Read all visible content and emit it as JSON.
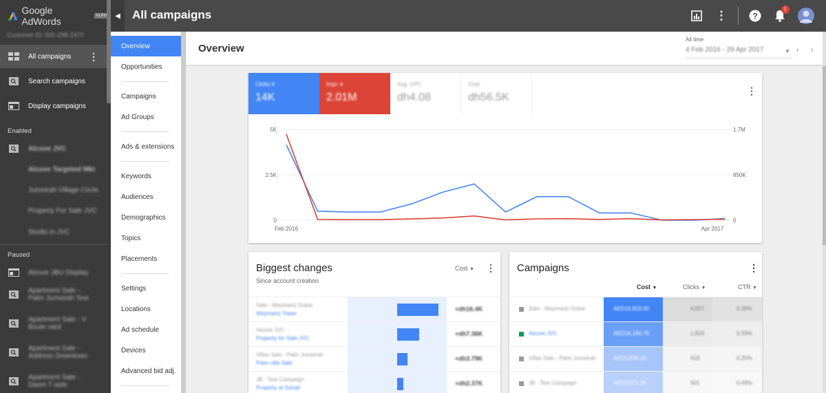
{
  "app": {
    "name": "Google AdWords",
    "badge": "ALPHA",
    "customer_id": "Customer ID: 591-298-1970"
  },
  "sidebar": {
    "top": [
      {
        "label": "All campaigns",
        "icon": "grid-icon"
      },
      {
        "label": "Search campaigns",
        "icon": "search-icon"
      },
      {
        "label": "Display campaigns",
        "icon": "display-icon"
      }
    ],
    "enabled_heading": "Enabled",
    "enabled": [
      {
        "label": "Alcove JVC",
        "icon": "search-icon",
        "bold": true
      },
      {
        "label": "Alcove Targeted Mkt",
        "bold": true
      },
      {
        "label": "Jumeirah Village Circle"
      },
      {
        "label": "Property For Sale JVC"
      },
      {
        "label": "Studio in JVC"
      }
    ],
    "paused_heading": "Paused",
    "paused": [
      {
        "label": "Alcove JBU Display",
        "icon": "display-icon"
      },
      {
        "label": "Apartment Sale - Palm Jumeirah Test",
        "icon": "search-icon"
      },
      {
        "label": "Apartment Sale - V Boule vard",
        "icon": "search-icon"
      },
      {
        "label": "Apartment Sale - Address Downtown",
        "icon": "search-icon"
      },
      {
        "label": "Apartment Sale - Dasm T aste",
        "icon": "search-icon"
      }
    ]
  },
  "topbar": {
    "title": "All campaigns",
    "notification_badge": "!"
  },
  "subnav": [
    {
      "label": "Overview",
      "active": true
    },
    {
      "label": "Opportunities"
    },
    {
      "label": "Campaigns"
    },
    {
      "label": "Ad Groups"
    },
    {
      "label": "Ads & extensions"
    },
    {
      "label": "Keywords"
    },
    {
      "label": "Audiences"
    },
    {
      "label": "Demographics"
    },
    {
      "label": "Topics"
    },
    {
      "label": "Placements"
    },
    {
      "label": "Settings"
    },
    {
      "label": "Locations"
    },
    {
      "label": "Ad schedule"
    },
    {
      "label": "Devices"
    },
    {
      "label": "Advanced bid adj."
    }
  ],
  "overview": {
    "title": "Overview",
    "date_label": "All time",
    "date_range": "4 Feb 2016 - 29 Apr 2017"
  },
  "metrics": [
    {
      "label": "Clicks ▾",
      "value": "14K",
      "color": "#4285f4"
    },
    {
      "label": "Impr. ▾",
      "value": "2.01M",
      "color": "#db4437"
    },
    {
      "label": "Avg. CPC",
      "value": "dh4.08",
      "color": "#ffffff"
    },
    {
      "label": "Cost",
      "value": "dh56.5K",
      "color": "#ffffff"
    }
  ],
  "chart_data": {
    "type": "line",
    "x": [
      "Feb 2016",
      "",
      "",
      "",
      "",
      "",
      "",
      "",
      "",
      "",
      "",
      "",
      "",
      "",
      "Apr 2017"
    ],
    "x_tick_labels": [
      "Feb 2016",
      "Apr 2017"
    ],
    "y_left": {
      "ticks": [
        "0",
        "2.5K",
        "5K"
      ],
      "range": [
        0,
        5000
      ]
    },
    "y_right": {
      "ticks": [
        "0",
        "850K",
        "1.7M"
      ],
      "range": [
        0,
        1700000
      ]
    },
    "series": [
      {
        "color": "#4285f4",
        "axis": "left",
        "values": [
          4150,
          500,
          450,
          450,
          900,
          1550,
          2000,
          450,
          1300,
          1300,
          400,
          400,
          0,
          0,
          100
        ]
      },
      {
        "color": "#db4437",
        "axis": "right",
        "values": [
          1610000,
          16000,
          12000,
          12000,
          25000,
          42000,
          80000,
          8000,
          26000,
          30000,
          16000,
          30000,
          8000,
          12000,
          18000
        ]
      }
    ]
  },
  "biggest_changes": {
    "title": "Biggest changes",
    "subtitle": "Since account creation",
    "sort_label": "Cost",
    "rows": [
      {
        "name": "Sale - Waymartz Dubai",
        "link": "Waymartz Tower",
        "bar": 0.8,
        "value": "+dh16.4K"
      },
      {
        "name": "Alcove JVC",
        "link": "Property for Sale JVC",
        "bar": 0.42,
        "value": "+dh7.36K"
      },
      {
        "name": "Villas Sale - Palm Jumeirah",
        "link": "Palm villa Sale",
        "bar": 0.2,
        "value": "+dh3.79K"
      },
      {
        "name": "JB - Test Campaign",
        "link": "Property at Sohail",
        "bar": 0.12,
        "value": "+dh2.37K"
      }
    ]
  },
  "campaigns": {
    "title": "Campaigns",
    "columns": [
      "Cost",
      "Clicks",
      "CTR"
    ],
    "rows": [
      {
        "name": "Sale - Waymartz Dubai",
        "status": "#999999",
        "cost": "AED16,819.00",
        "clicks": "4,007",
        "ctr": "0.39%"
      },
      {
        "name": "Alcove JVC",
        "status": "#0f9d58",
        "cost": "AED16,184.75",
        "clicks": "1,824",
        "ctr": "0.33%"
      },
      {
        "name": "Villas Sale - Palm Jumeirah",
        "status": "#999999",
        "cost": "AED3,830.13",
        "clicks": "418",
        "ctr": "0.25%"
      },
      {
        "name": "JB - Test Campaign",
        "status": "#999999",
        "cost": "AED3,071.26",
        "clicks": "501",
        "ctr": "0.49%"
      }
    ]
  }
}
